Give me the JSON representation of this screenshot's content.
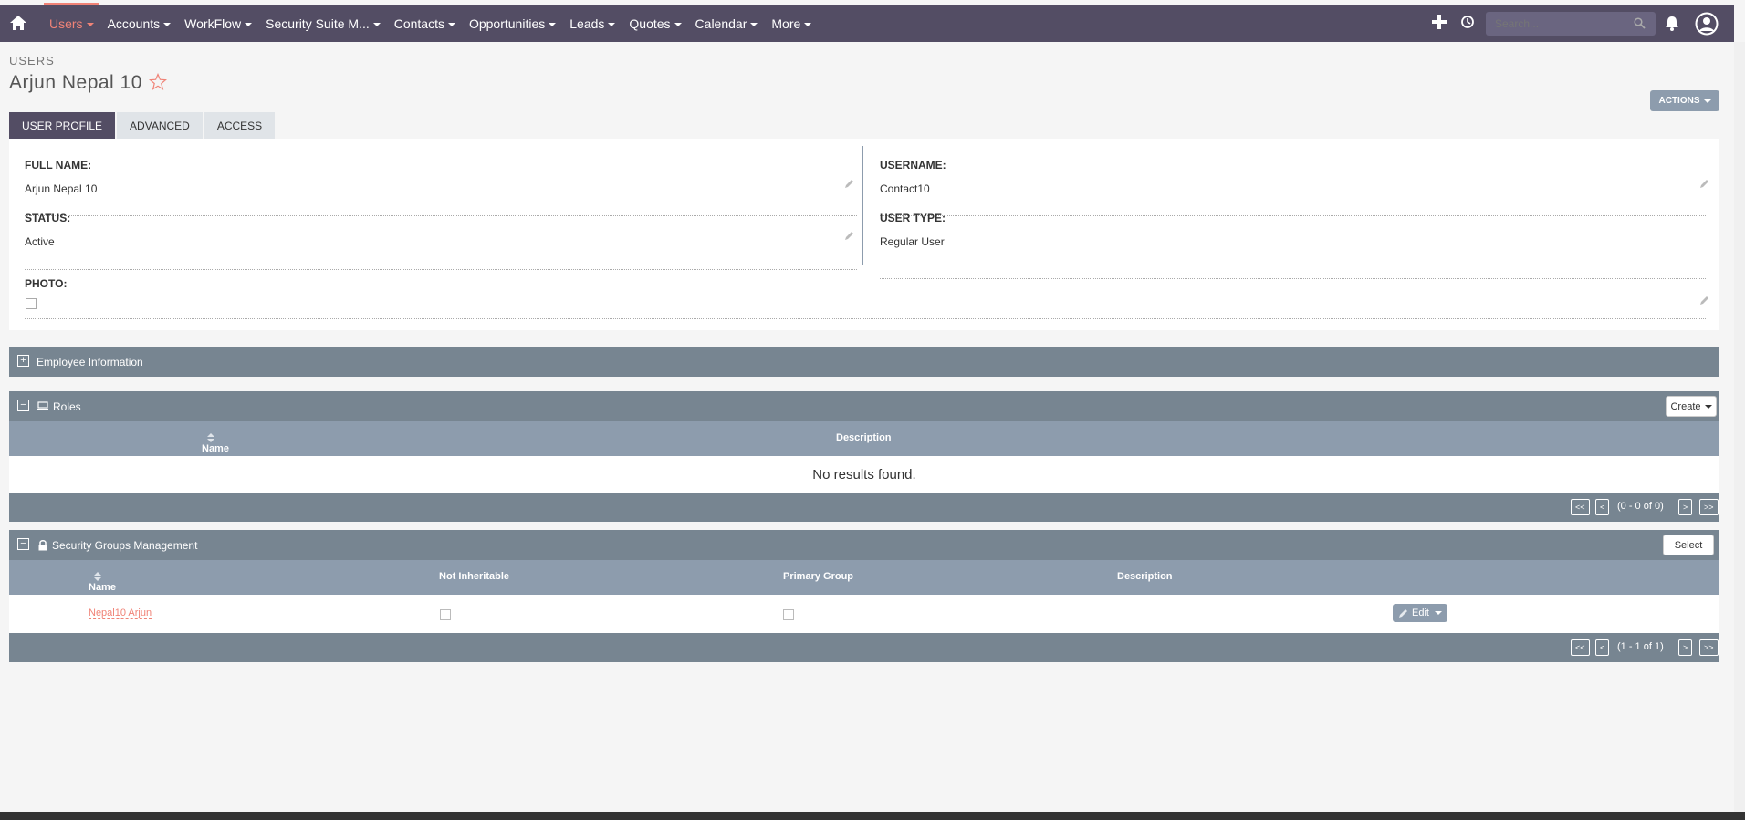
{
  "nav": {
    "items": [
      "Users",
      "Accounts",
      "WorkFlow",
      "Security Suite M...",
      "Contacts",
      "Opportunities",
      "Leads",
      "Quotes",
      "Calendar",
      "More"
    ],
    "search_placeholder": "Search..."
  },
  "header": {
    "module": "USERS",
    "title": "Arjun Nepal 10",
    "actions_label": "ACTIONS"
  },
  "tabs": [
    "USER PROFILE",
    "ADVANCED",
    "ACCESS"
  ],
  "profile": {
    "full_name_label": "FULL NAME:",
    "full_name": "Arjun Nepal 10",
    "username_label": "USERNAME:",
    "username": "Contact10",
    "status_label": "STATUS:",
    "status": "Active",
    "user_type_label": "USER TYPE:",
    "user_type": "Regular User",
    "photo_label": "PHOTO:"
  },
  "employee_panel": {
    "title": "Employee Information",
    "toggle": "+"
  },
  "roles_panel": {
    "title": "Roles",
    "toggle": "−",
    "create_label": "Create",
    "columns": [
      "Name",
      "Description"
    ],
    "empty_text": "No results found.",
    "pager": {
      "first": "<<",
      "prev": "<",
      "range": "(0 - 0 of 0)",
      "next": ">",
      "last": ">>"
    }
  },
  "security_panel": {
    "title": "Security Groups Management",
    "toggle": "−",
    "select_label": "Select",
    "columns": [
      "Name",
      "Not Inheritable",
      "Primary Group",
      "Description"
    ],
    "rows": [
      {
        "name": "Nepal10 Arjun",
        "edit_label": "Edit"
      }
    ],
    "pager": {
      "first": "<<",
      "prev": "<",
      "range": "(1 - 1 of 1)",
      "next": ">",
      "last": ">>"
    }
  },
  "colors": {
    "topbar": "#534d64",
    "accent": "#f08377",
    "panel_head": "#778591",
    "column_head": "#8d9cad"
  }
}
